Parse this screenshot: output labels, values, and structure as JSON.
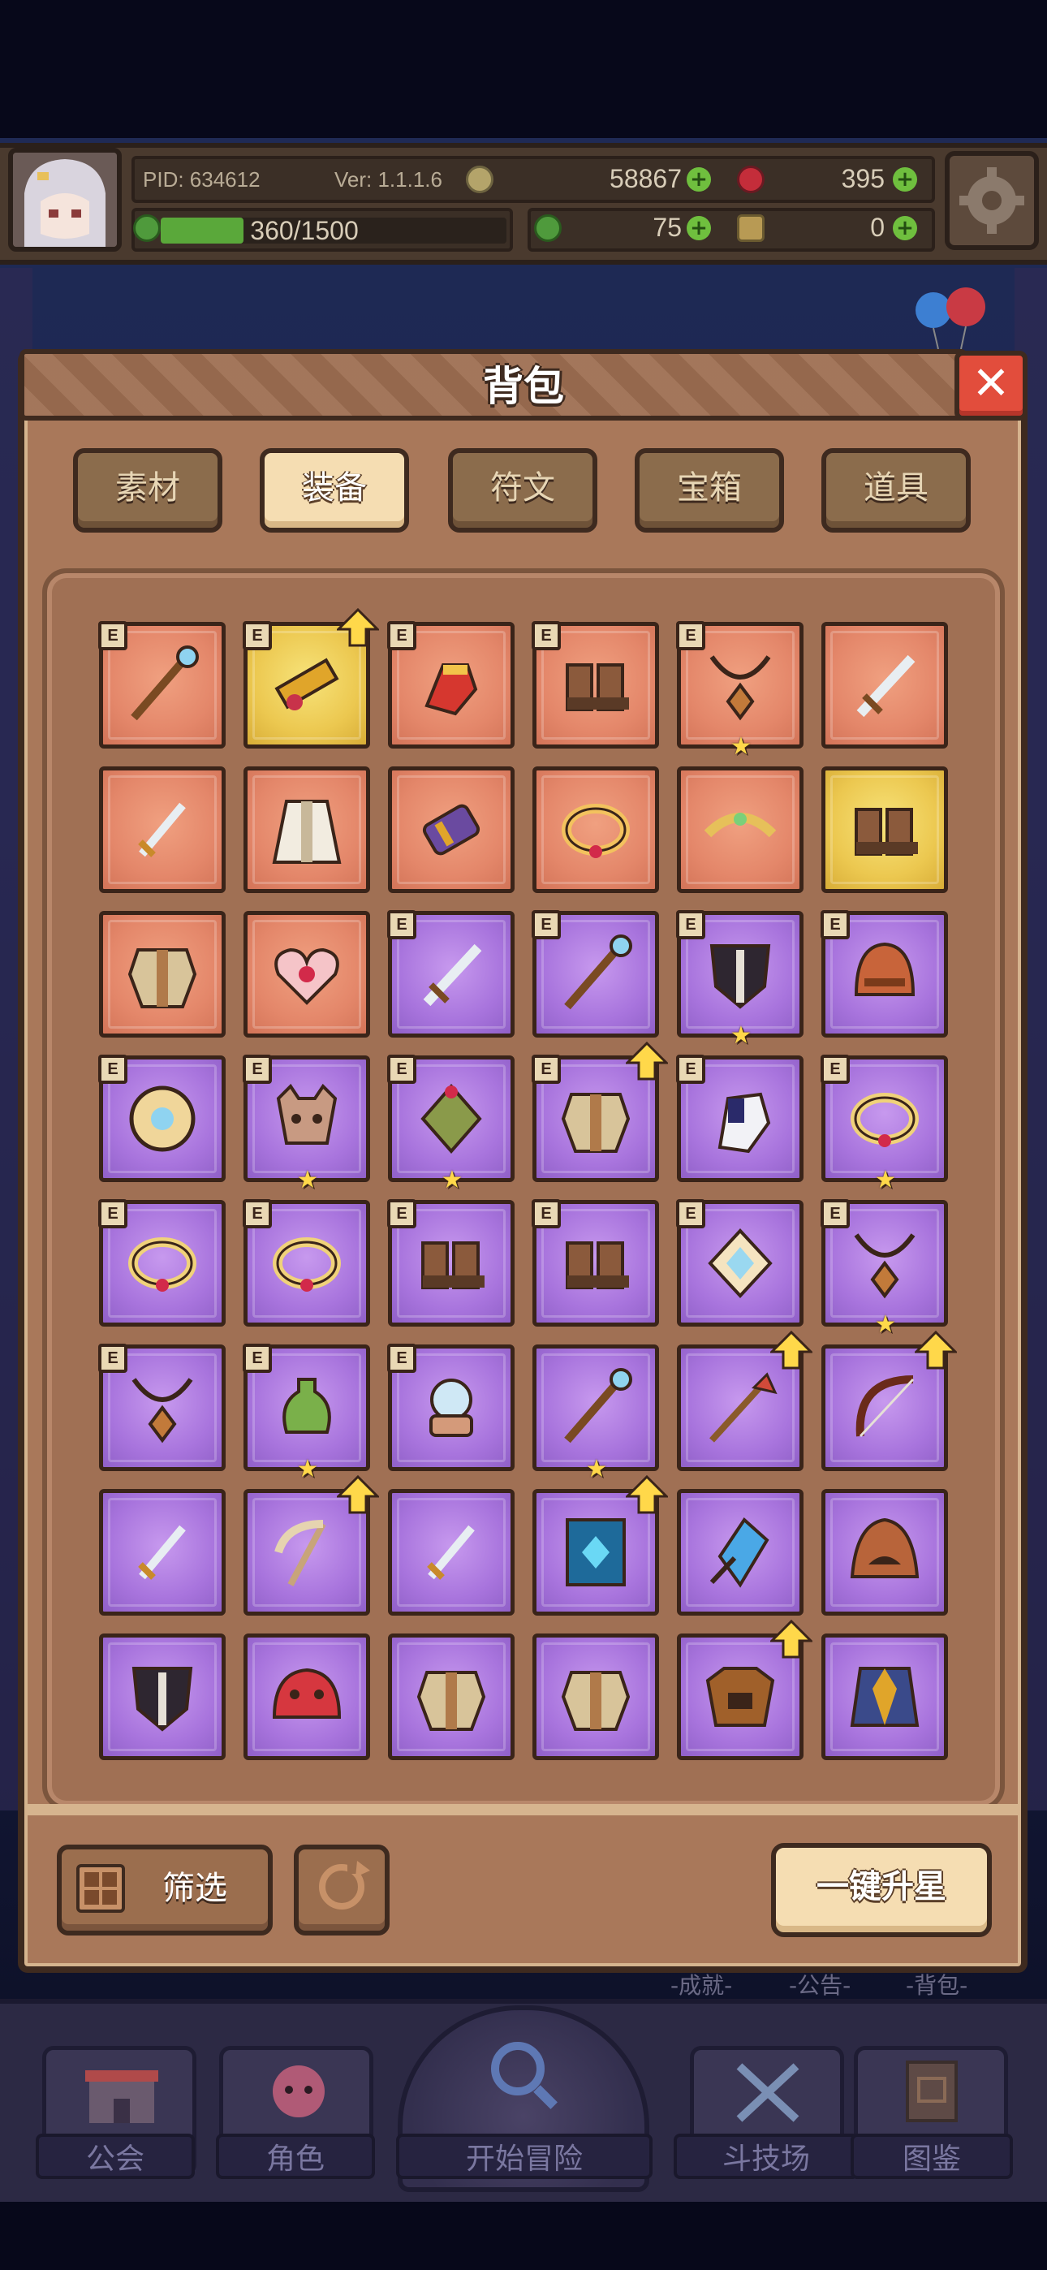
{
  "hud": {
    "pid": "PID: 634612",
    "version": "Ver: 1.1.1.6",
    "gold": "58867",
    "gems": "395",
    "stamina": "360/1500",
    "stamina_fraction": 0.24,
    "clover": "75",
    "keys": "0"
  },
  "modal": {
    "title": "背包",
    "close_symbol": "✕",
    "tabs": [
      "素材",
      "装备",
      "符文",
      "宝箱",
      "道具"
    ],
    "active_tab": "装备",
    "filter_label": "筛选",
    "one_key_star_label": "一键升星"
  },
  "items": [
    {
      "bg": "orange",
      "e": true,
      "up": false,
      "star": false,
      "icon": "staff-icon"
    },
    {
      "bg": "gold",
      "e": true,
      "up": true,
      "star": false,
      "icon": "golden-cannon-icon"
    },
    {
      "bg": "orange",
      "e": true,
      "up": false,
      "star": false,
      "icon": "gauntlet-icon"
    },
    {
      "bg": "orange",
      "e": true,
      "up": false,
      "star": false,
      "icon": "boots-icon"
    },
    {
      "bg": "orange",
      "e": true,
      "up": false,
      "star": true,
      "icon": "amulet-icon"
    },
    {
      "bg": "orange",
      "e": false,
      "up": false,
      "star": false,
      "icon": "sword-icon"
    },
    {
      "bg": "orange",
      "e": false,
      "up": false,
      "star": false,
      "icon": "dagger-icon"
    },
    {
      "bg": "orange",
      "e": false,
      "up": false,
      "star": false,
      "icon": "robe-icon"
    },
    {
      "bg": "orange",
      "e": false,
      "up": false,
      "star": false,
      "icon": "bracer-icon"
    },
    {
      "bg": "orange",
      "e": false,
      "up": false,
      "star": false,
      "icon": "ring-icon"
    },
    {
      "bg": "orange",
      "e": false,
      "up": false,
      "star": false,
      "icon": "tiara-icon"
    },
    {
      "bg": "gold",
      "e": false,
      "up": false,
      "star": false,
      "icon": "boots-icon"
    },
    {
      "bg": "orange",
      "e": false,
      "up": false,
      "star": false,
      "icon": "armor-icon"
    },
    {
      "bg": "orange",
      "e": false,
      "up": false,
      "star": false,
      "icon": "heart-emblem-icon"
    },
    {
      "bg": "purple",
      "e": true,
      "up": false,
      "star": false,
      "icon": "sword-icon"
    },
    {
      "bg": "purple",
      "e": true,
      "up": false,
      "star": false,
      "icon": "staff-icon"
    },
    {
      "bg": "purple",
      "e": true,
      "up": false,
      "star": true,
      "icon": "shield-icon"
    },
    {
      "bg": "purple",
      "e": true,
      "up": false,
      "star": false,
      "icon": "helmet-icon"
    },
    {
      "bg": "purple",
      "e": true,
      "up": false,
      "star": false,
      "icon": "round-shield-icon"
    },
    {
      "bg": "purple",
      "e": true,
      "up": false,
      "star": true,
      "icon": "skull-helm-icon"
    },
    {
      "bg": "purple",
      "e": true,
      "up": false,
      "star": true,
      "icon": "lantern-icon"
    },
    {
      "bg": "purple",
      "e": true,
      "up": true,
      "star": false,
      "icon": "armor-icon"
    },
    {
      "bg": "purple",
      "e": true,
      "up": false,
      "star": false,
      "icon": "glove-icon"
    },
    {
      "bg": "purple",
      "e": true,
      "up": false,
      "star": true,
      "icon": "ring-icon"
    },
    {
      "bg": "purple",
      "e": true,
      "up": false,
      "star": false,
      "icon": "ring-icon"
    },
    {
      "bg": "purple",
      "e": true,
      "up": false,
      "star": false,
      "icon": "ring-icon"
    },
    {
      "bg": "purple",
      "e": true,
      "up": false,
      "star": false,
      "icon": "boots-icon"
    },
    {
      "bg": "purple",
      "e": true,
      "up": false,
      "star": false,
      "icon": "boots-icon"
    },
    {
      "bg": "purple",
      "e": true,
      "up": false,
      "star": false,
      "icon": "gem-icon"
    },
    {
      "bg": "purple",
      "e": true,
      "up": false,
      "star": true,
      "icon": "amulet-icon"
    },
    {
      "bg": "purple",
      "e": true,
      "up": false,
      "star": false,
      "icon": "amulet-icon"
    },
    {
      "bg": "purple",
      "e": true,
      "up": false,
      "star": true,
      "icon": "potion-icon"
    },
    {
      "bg": "purple",
      "e": true,
      "up": false,
      "star": false,
      "icon": "orb-icon"
    },
    {
      "bg": "purple",
      "e": false,
      "up": false,
      "star": true,
      "icon": "staff-icon"
    },
    {
      "bg": "purple",
      "e": false,
      "up": true,
      "star": false,
      "icon": "spear-icon"
    },
    {
      "bg": "purple",
      "e": false,
      "up": true,
      "star": false,
      "icon": "bow-icon"
    },
    {
      "bg": "purple",
      "e": false,
      "up": false,
      "star": false,
      "icon": "dagger-icon"
    },
    {
      "bg": "purple",
      "e": false,
      "up": true,
      "star": false,
      "icon": "scythe-icon"
    },
    {
      "bg": "purple",
      "e": false,
      "up": false,
      "star": false,
      "icon": "dagger-icon"
    },
    {
      "bg": "purple",
      "e": false,
      "up": true,
      "star": false,
      "icon": "spellbook-icon"
    },
    {
      "bg": "purple",
      "e": false,
      "up": false,
      "star": false,
      "icon": "crystal-icon"
    },
    {
      "bg": "purple",
      "e": false,
      "up": false,
      "star": false,
      "icon": "hood-icon"
    },
    {
      "bg": "purple",
      "e": false,
      "up": false,
      "star": false,
      "icon": "shield-icon"
    },
    {
      "bg": "purple",
      "e": false,
      "up": false,
      "star": false,
      "icon": "slime-helm-icon"
    },
    {
      "bg": "purple",
      "e": false,
      "up": false,
      "star": false,
      "icon": "armor-icon"
    },
    {
      "bg": "purple",
      "e": false,
      "up": false,
      "star": false,
      "icon": "armor-icon"
    },
    {
      "bg": "purple",
      "e": false,
      "up": true,
      "star": false,
      "icon": "beast-helm-icon"
    },
    {
      "bg": "purple",
      "e": false,
      "up": false,
      "star": false,
      "icon": "coat-icon"
    }
  ],
  "badge_letter": "E",
  "star_symbol": "★",
  "under_labels": [
    "-成就-",
    "-公告-",
    "-背包-"
  ],
  "nav": {
    "items": [
      "公会",
      "角色",
      "开始冒险",
      "斗技场",
      "图鉴"
    ]
  },
  "colors": {
    "panel": "#a9785a",
    "orange_slot": "#e4876a",
    "gold_slot": "#ecc850",
    "purple_slot": "#a874dd",
    "close": "#e24d3c"
  }
}
